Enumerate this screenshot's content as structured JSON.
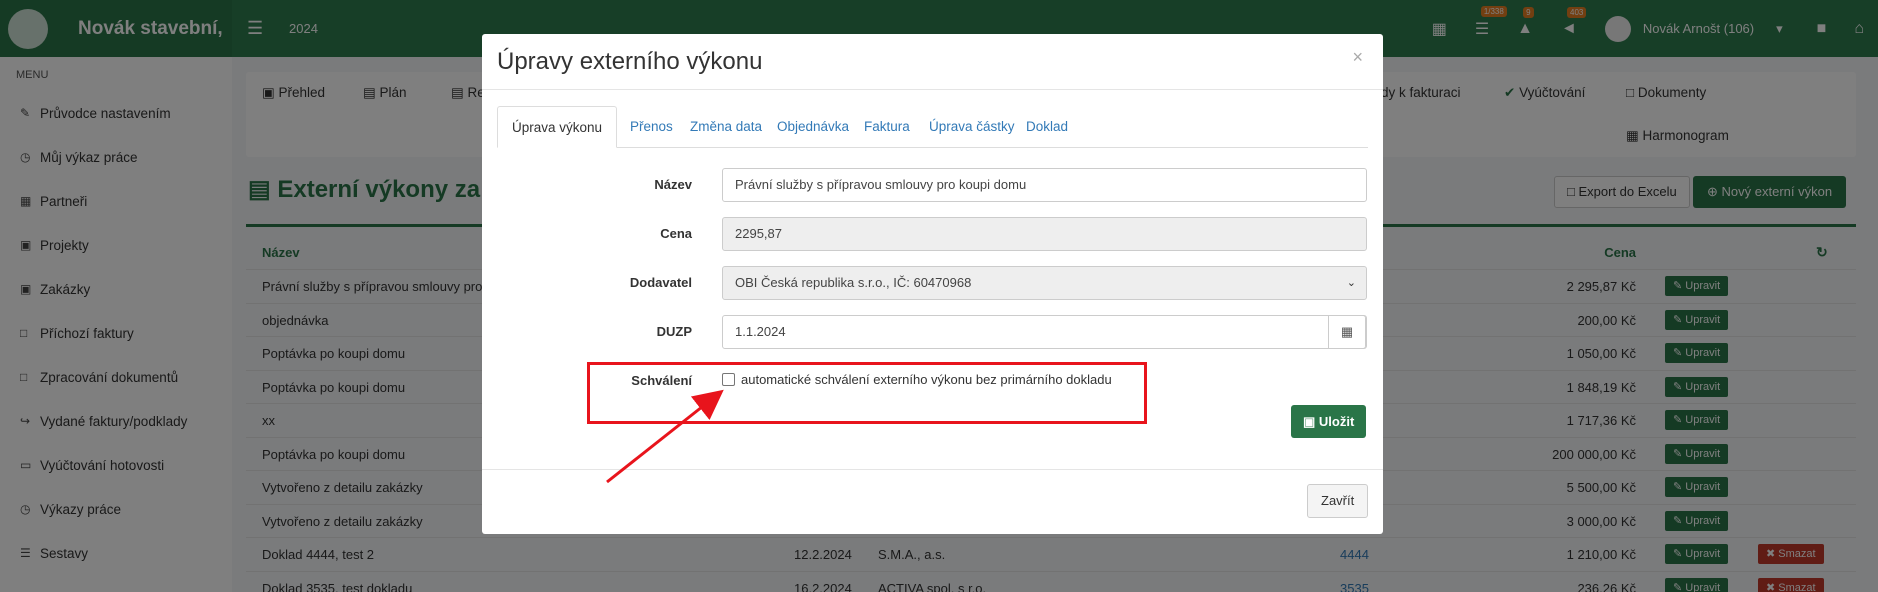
{
  "app": {
    "brand": "Novák stavební,",
    "year": "2024",
    "user": "Novák Arnošt (106)",
    "badges": [
      "1/338",
      "9",
      "403"
    ]
  },
  "sidebar": {
    "heading": "MENU",
    "items": [
      {
        "label": "Průvodce nastavením",
        "icon": "pencil-icon"
      },
      {
        "label": "Můj výkaz práce",
        "icon": "clock-icon"
      },
      {
        "label": "Partneři",
        "icon": "building-icon"
      },
      {
        "label": "Projekty",
        "icon": "cubes-icon"
      },
      {
        "label": "Zakázky",
        "icon": "cube-icon"
      },
      {
        "label": "Příchozí faktury",
        "icon": "file-icon"
      },
      {
        "label": "Zpracování dokumentů",
        "icon": "file-icon"
      },
      {
        "label": "Vydané faktury/podklady",
        "icon": "share-icon"
      },
      {
        "label": "Vyúčtování hotovosti",
        "icon": "money-icon"
      },
      {
        "label": "Výkazy práce",
        "icon": "clock-icon"
      },
      {
        "label": "Sestavy",
        "icon": "list-icon"
      }
    ]
  },
  "page_tabs": {
    "prehled": "Přehled",
    "plan": "Plán",
    "re": "Re",
    "k_fakturaci": "dy k fakturaci",
    "vyuctovani": "Vyúčtování",
    "dokumenty": "Dokumenty",
    "harmonogram": "Harmonogram"
  },
  "page": {
    "title": "Externí výkony za",
    "export_label": "Export do Excelu",
    "new_label": "Nový externí výkon"
  },
  "table": {
    "col_name": "Název",
    "col_price": "Cena",
    "edit_label": "Upravit",
    "delete_label": "Smazat",
    "rows": [
      {
        "name": "Právní služby s přípravou smlouvy pro",
        "date": "",
        "supplier": "",
        "doc": "",
        "price": "2 295,87 Kč",
        "del": false
      },
      {
        "name": "objednávka",
        "date": "",
        "supplier": "",
        "doc": "",
        "price": "200,00 Kč",
        "del": false
      },
      {
        "name": "Poptávka po koupi domu",
        "date": "",
        "supplier": "",
        "doc": "",
        "price": "1 050,00 Kč",
        "del": false
      },
      {
        "name": "Poptávka po koupi domu",
        "date": "",
        "supplier": "",
        "doc": "",
        "price": "1 848,19 Kč",
        "del": false
      },
      {
        "name": "xx",
        "date": "",
        "supplier": "",
        "doc": "",
        "price": "1 717,36 Kč",
        "del": false
      },
      {
        "name": "Poptávka po koupi domu",
        "date": "",
        "supplier": "",
        "doc": "",
        "price": "200 000,00 Kč",
        "del": false
      },
      {
        "name": "Vytvořeno z detailu zakázky",
        "date": "",
        "supplier": "",
        "doc": "",
        "price": "5 500,00 Kč",
        "del": false
      },
      {
        "name": "Vytvořeno z detailu zakázky",
        "date": "",
        "supplier": "",
        "doc": "",
        "price": "3 000,00 Kč",
        "del": false
      },
      {
        "name": "Doklad 4444, test 2",
        "date": "12.2.2024",
        "supplier": "S.M.A., a.s.",
        "doc": "4444",
        "price": "1 210,00 Kč",
        "del": true
      },
      {
        "name": "Doklad 3535, test dokladu",
        "date": "16.2.2024",
        "supplier": "ACTIVA spol. s r.o.",
        "doc": "3535",
        "price": "236,26 Kč",
        "del": true
      }
    ]
  },
  "modal": {
    "title": "Úpravy externího výkonu",
    "close_x": "×",
    "tabs": [
      "Úprava výkonu",
      "Přenos",
      "Změna data",
      "Objednávka",
      "Faktura",
      "Úprava částky",
      "Doklad"
    ],
    "fields": {
      "name_label": "Název",
      "name_value": "Právní služby s přípravou smlouvy pro koupi domu",
      "price_label": "Cena",
      "price_value": "2295,87",
      "supplier_label": "Dodavatel",
      "supplier_value": "OBI Česká republika s.r.o., IČ: 60470968",
      "duzp_label": "DUZP",
      "duzp_value": "1.1.2024",
      "approval_label": "Schválení",
      "approval_text": "automatické schválení externího výkonu bez primárního dokladu",
      "approval_checked": false
    },
    "save_label": "Uložit",
    "close_label": "Zavřít"
  },
  "colors": {
    "brand_green": "#2a7548",
    "highlight_red": "#e8141c"
  }
}
